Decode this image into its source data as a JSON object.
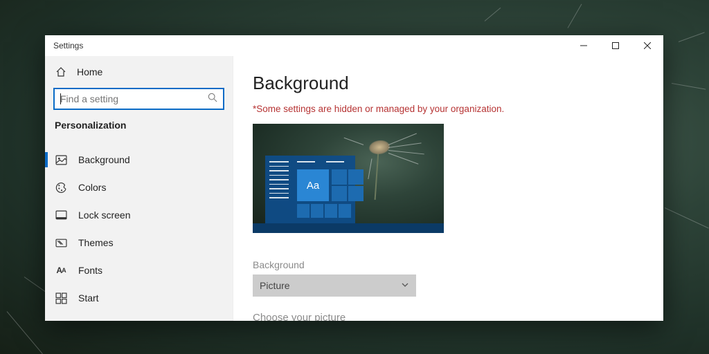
{
  "window": {
    "title": "Settings"
  },
  "sidebar": {
    "home": "Home",
    "search_placeholder": "Find a setting",
    "section": "Personalization",
    "items": [
      {
        "label": "Background",
        "icon": "image-icon",
        "active": true
      },
      {
        "label": "Colors",
        "icon": "palette-icon",
        "active": false
      },
      {
        "label": "Lock screen",
        "icon": "lock-screen-icon",
        "active": false
      },
      {
        "label": "Themes",
        "icon": "themes-icon",
        "active": false
      },
      {
        "label": "Fonts",
        "icon": "fonts-icon",
        "active": false
      },
      {
        "label": "Start",
        "icon": "start-icon",
        "active": false
      }
    ]
  },
  "main": {
    "title": "Background",
    "warning": "*Some settings are hidden or managed by your organization.",
    "preview_sample_text": "Aa",
    "background_field_label": "Background",
    "background_dropdown_value": "Picture",
    "choose_picture_label": "Choose your picture"
  }
}
